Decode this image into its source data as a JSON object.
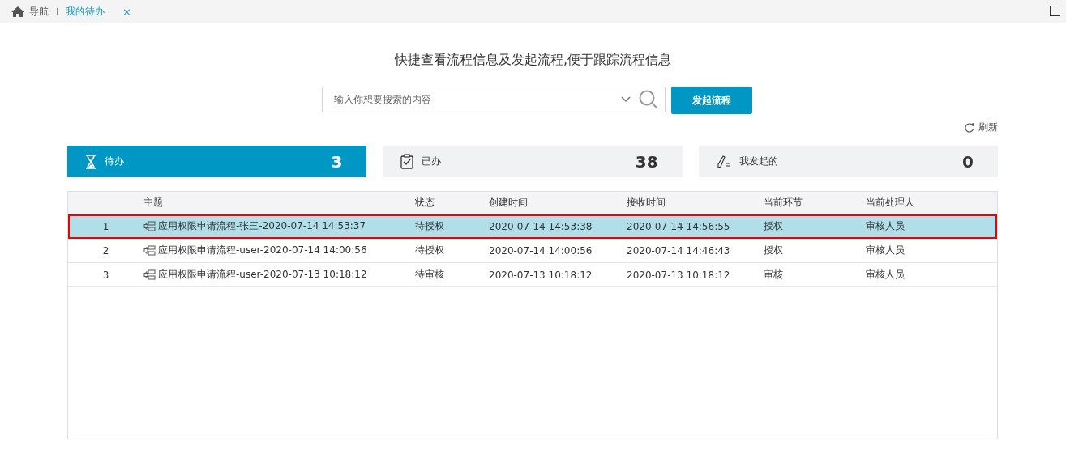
{
  "nav_tabs": [
    {
      "label": "导航",
      "kind": "home",
      "selected": false
    },
    {
      "label": "我的待办",
      "kind": "closable",
      "close": "×",
      "selected": true
    }
  ],
  "heading": "快捷查看流程信息及发起流程,便于跟踪流程信息",
  "search": {
    "placeholder": "输入你想要搜索的内容"
  },
  "start_button": "发起流程",
  "refresh": "刷新",
  "summary_tabs": [
    {
      "label": "待办",
      "count": "3",
      "kind": "hourglass",
      "selected": true
    },
    {
      "label": "已办",
      "count": "38",
      "kind": "clipboard",
      "selected": false
    },
    {
      "label": "我发起的",
      "count": "0",
      "kind": "pen",
      "selected": false
    }
  ],
  "table": {
    "columns": [
      "",
      "主题",
      "状态",
      "创建时间",
      "接收时间",
      "当前环节",
      "当前处理人"
    ],
    "rows": [
      {
        "cells": [
          "1",
          "应用权限申请流程-张三-2020-07-14 14:53:37",
          "待授权",
          "2020-07-14 14:53:38",
          "2020-07-14 14:56:55",
          "授权",
          "审核人员"
        ],
        "selected": true
      },
      {
        "cells": [
          "2",
          "应用权限申请流程-user-2020-07-14 14:00:56",
          "待授权",
          "2020-07-14 14:00:56",
          "2020-07-14 14:46:43",
          "授权",
          "审核人员"
        ],
        "selected": false
      },
      {
        "cells": [
          "3",
          "应用权限申请流程-user-2020-07-13 10:18:12",
          "待审核",
          "2020-07-13 10:18:12",
          "2020-07-13 10:18:12",
          "审核",
          "审核人员"
        ],
        "selected": false
      }
    ]
  }
}
